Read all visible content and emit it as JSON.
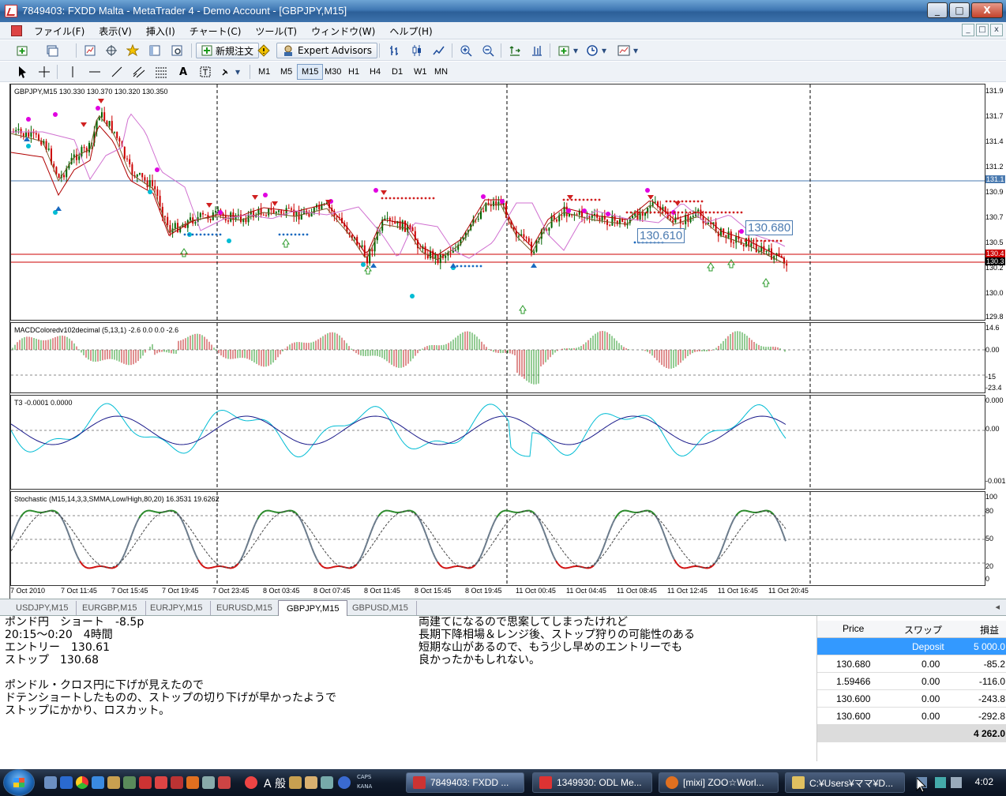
{
  "window": {
    "title": "7849403: FXDD Malta - MetaTrader 4 - Demo Account - [GBPJPY,M15]",
    "buttons": {
      "minimize": "_",
      "maximize": "□",
      "close": "X"
    }
  },
  "menu": {
    "items": [
      "ファイル(F)",
      "表示(V)",
      "挿入(I)",
      "チャート(C)",
      "ツール(T)",
      "ウィンドウ(W)",
      "ヘルプ(H)"
    ],
    "mdi_buttons": [
      "_",
      "□",
      "x"
    ]
  },
  "toolbar": {
    "new_order": "新規注文",
    "expert_advisors": "Expert Advisors",
    "timeframes": [
      "M1",
      "M5",
      "M15",
      "M30",
      "H1",
      "H4",
      "D1",
      "W1",
      "MN"
    ],
    "active_timeframe": "M15"
  },
  "chart": {
    "main_label": "GBPJPY,M15  130.330 130.370 130.320 130.350",
    "macd_label": "MACDColoredv102decimal (5,13,1) -2.6 0.0 0.0 -2.6",
    "t3_label": "T3 -0.0001 0.0000",
    "stoch_label": "Stochastic (M15,14,3,3,SMMA,Low/High,80,20) 16.3531 19.6262",
    "annotation_1": "130.680",
    "annotation_2": "130.610",
    "price_axis": [
      "131.9",
      "131.7",
      "131.4",
      "131.2",
      "131.1",
      "130.9",
      "130.7",
      "130.5",
      "130.4",
      "130.3",
      "130.2",
      "130.0",
      "129.8"
    ],
    "macd_axis": [
      "14.6",
      "0.00",
      "-15",
      "-23.4"
    ],
    "t3_axis": [
      "0.000",
      "0.00",
      "-0.001"
    ],
    "stoch_axis": [
      "100",
      "80",
      "50",
      "20",
      "0"
    ],
    "time_axis": [
      "7 Oct 2010",
      "7 Oct 11:45",
      "7 Oct 15:45",
      "7 Oct 19:45",
      "7 Oct 23:45",
      "8 Oct 03:45",
      "8 Oct 07:45",
      "8 Oct 11:45",
      "8 Oct 15:45",
      "8 Oct 19:45",
      "11 Oct 00:45",
      "11 Oct 04:45",
      "11 Oct 08:45",
      "11 Oct 12:45",
      "11 Oct 16:45",
      "11 Oct 20:45"
    ],
    "colors": {
      "bull": "#006400",
      "bear": "#cc0000",
      "signal_magenta": "#e000e0",
      "cyan": "#00bcd4",
      "ma_red": "#b00000"
    }
  },
  "tabs": {
    "items": [
      "USDJPY,M15",
      "EURGBP,M15",
      "EURJPY,M15",
      "EURUSD,M15",
      "GBPJPY,M15",
      "GBPUSD,M15"
    ],
    "active": "GBPJPY,M15"
  },
  "memo": {
    "left": "ポンド円　ショート　-8.5p\n20:15〜0:20　4時間\nエントリー　130.61\nストップ　130.68\n\nポンドル・クロス円に下げが見えたので\nドテンショートしたものの、ストップの切り下げが早かったようで\nストップにかかり、ロスカット。",
    "right": "両建てになるので思案してしまったけれど\n長期下降相場＆レンジ後、ストップ狩りの可能性のある\n短期な山があるので、もう少し早めのエントリーでも\n良かったかもしれない。"
  },
  "terminal": {
    "headers": {
      "price": "Price",
      "swap": "スワップ",
      "profit": "損益"
    },
    "deposit_label": "Deposit",
    "deposit_value": "5 000.0",
    "rows": [
      {
        "price": "130.680",
        "swap": "0.00",
        "profit": "-85.2"
      },
      {
        "price": "1.59466",
        "swap": "0.00",
        "profit": "-116.0"
      },
      {
        "price": "130.600",
        "swap": "0.00",
        "profit": "-243.8"
      },
      {
        "price": "130.600",
        "swap": "0.00",
        "profit": "-292.8"
      }
    ],
    "total": "4 262.0"
  },
  "taskbar": {
    "ime_label": "A 般",
    "caps": "CAPS",
    "kana": "KANA",
    "tasks": [
      "7849403: FXDD ...",
      "1349930: ODL Me...",
      "[mixi] ZOO☆Worl...",
      "C:¥Users¥ママ¥D..."
    ],
    "clock": "4:02"
  }
}
